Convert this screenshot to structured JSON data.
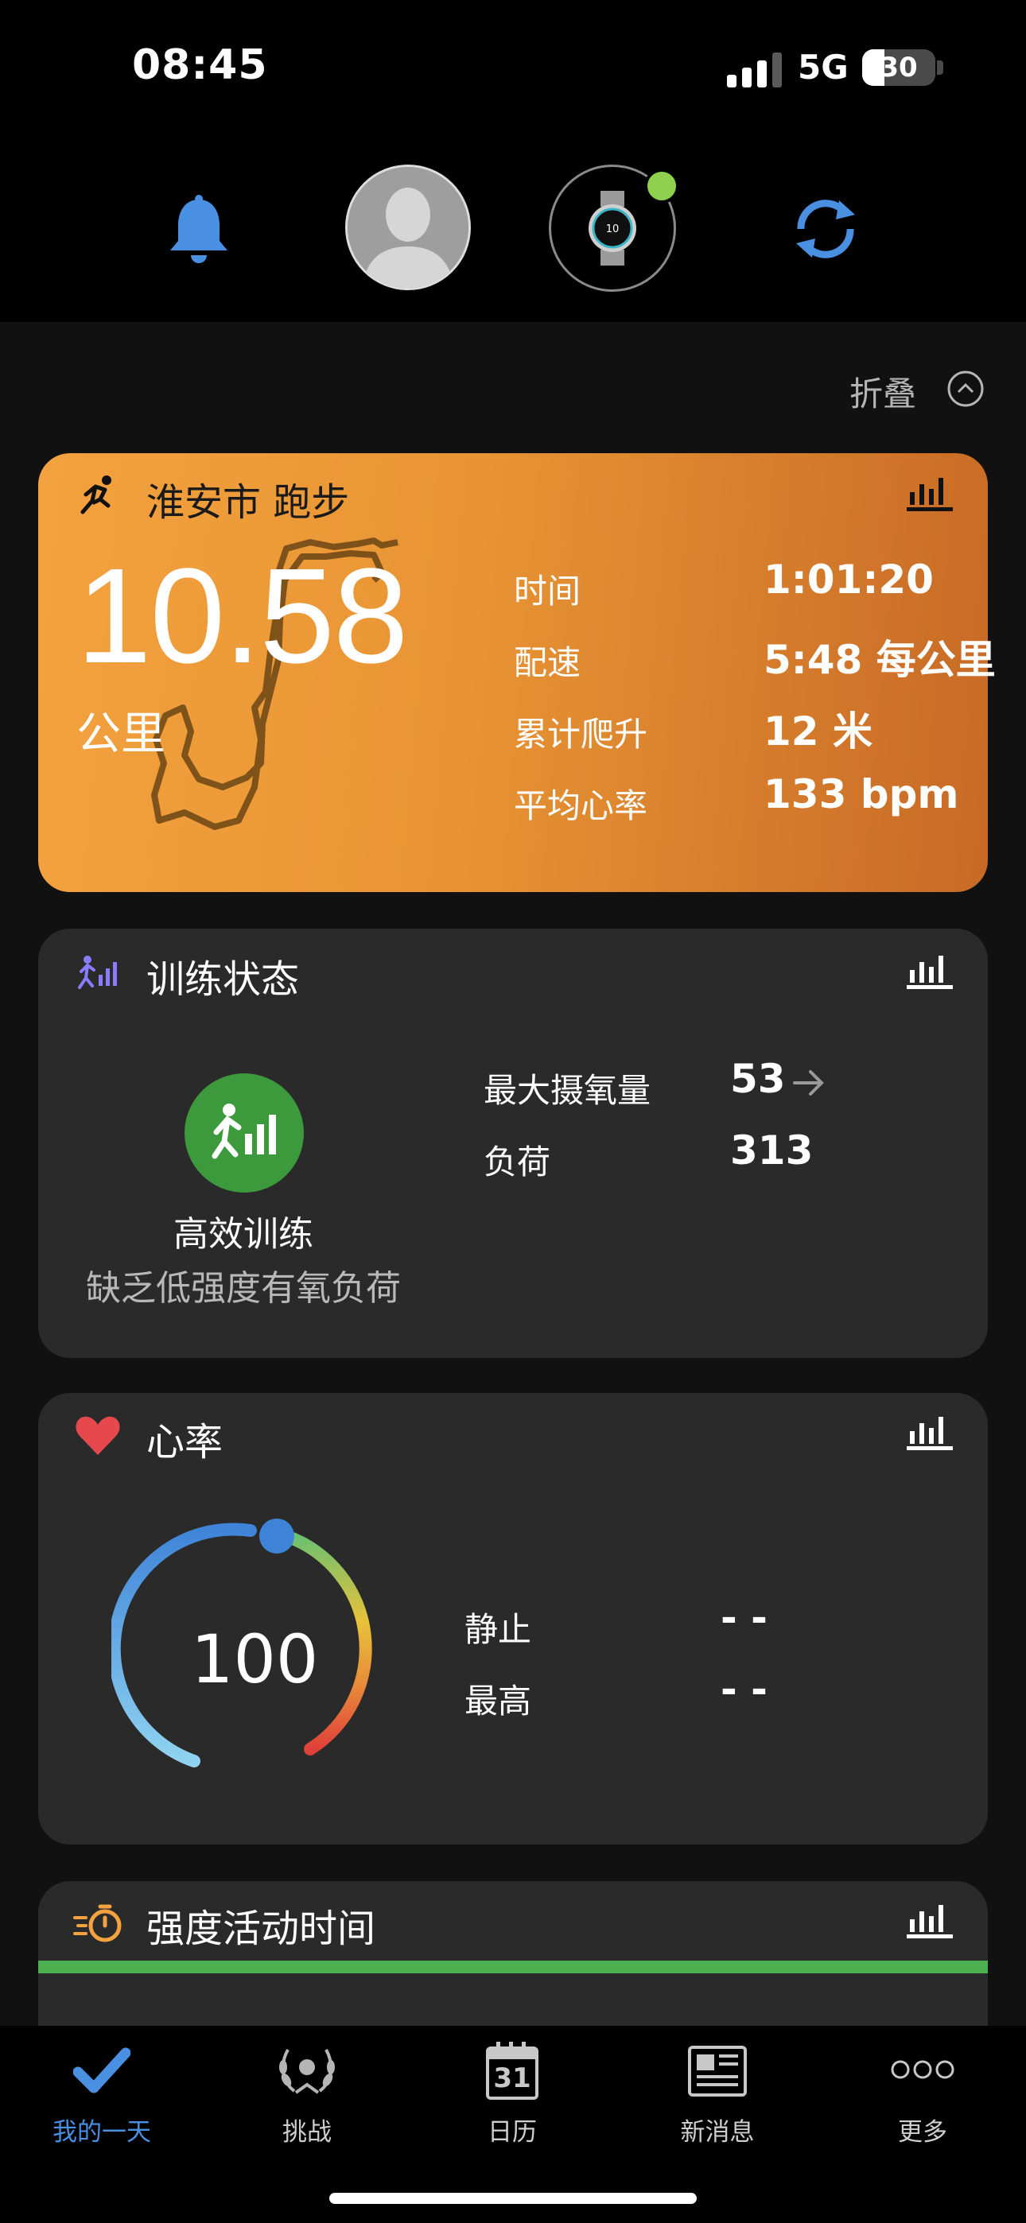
{
  "status_bar": {
    "time": "08:45",
    "network": "5G",
    "battery": "30",
    "battery_level": 0.3
  },
  "header": {
    "bell_icon": "bell-icon",
    "avatar_icon": "profile-avatar",
    "device_icon": "watch-icon",
    "sync_icon": "sync-icon",
    "device_status_color": "#8fd14f"
  },
  "collapse_label": "折叠",
  "activity": {
    "title": "淮安市 跑步",
    "distance": "10.58",
    "unit": "公里",
    "stats": [
      {
        "label": "时间",
        "value": "1:01:20"
      },
      {
        "label": "配速",
        "value": "5:48 每公里"
      },
      {
        "label": "累计爬升",
        "value": "12 米"
      },
      {
        "label": "平均心率",
        "value": "133 bpm"
      }
    ]
  },
  "training": {
    "title": "训练状态",
    "status": "高效训练",
    "note": "缺乏低强度有氧负荷",
    "stats": [
      {
        "label": "最大摄氧量",
        "value": "53"
      },
      {
        "label": "负荷",
        "value": "313"
      }
    ]
  },
  "heart_rate": {
    "title": "心率",
    "current": "100",
    "stats": [
      {
        "label": "静止",
        "value": "- -"
      },
      {
        "label": "最高",
        "value": "- -"
      }
    ]
  },
  "intensity": {
    "title": "强度活动时间",
    "bar_color": "#4caf50"
  },
  "tabs": [
    {
      "label": "我的一天",
      "icon": "check-icon",
      "active": true
    },
    {
      "label": "挑战",
      "icon": "laurel-icon"
    },
    {
      "label": "日历",
      "icon": "calendar-icon",
      "day": "31"
    },
    {
      "label": "新消息",
      "icon": "news-icon"
    },
    {
      "label": "更多",
      "icon": "more-icon"
    }
  ],
  "colors": {
    "accent": "#4a90e2",
    "activity_orange": "#f3a23f",
    "training_green": "#3c9a3c",
    "heart_red": "#e5484d"
  }
}
